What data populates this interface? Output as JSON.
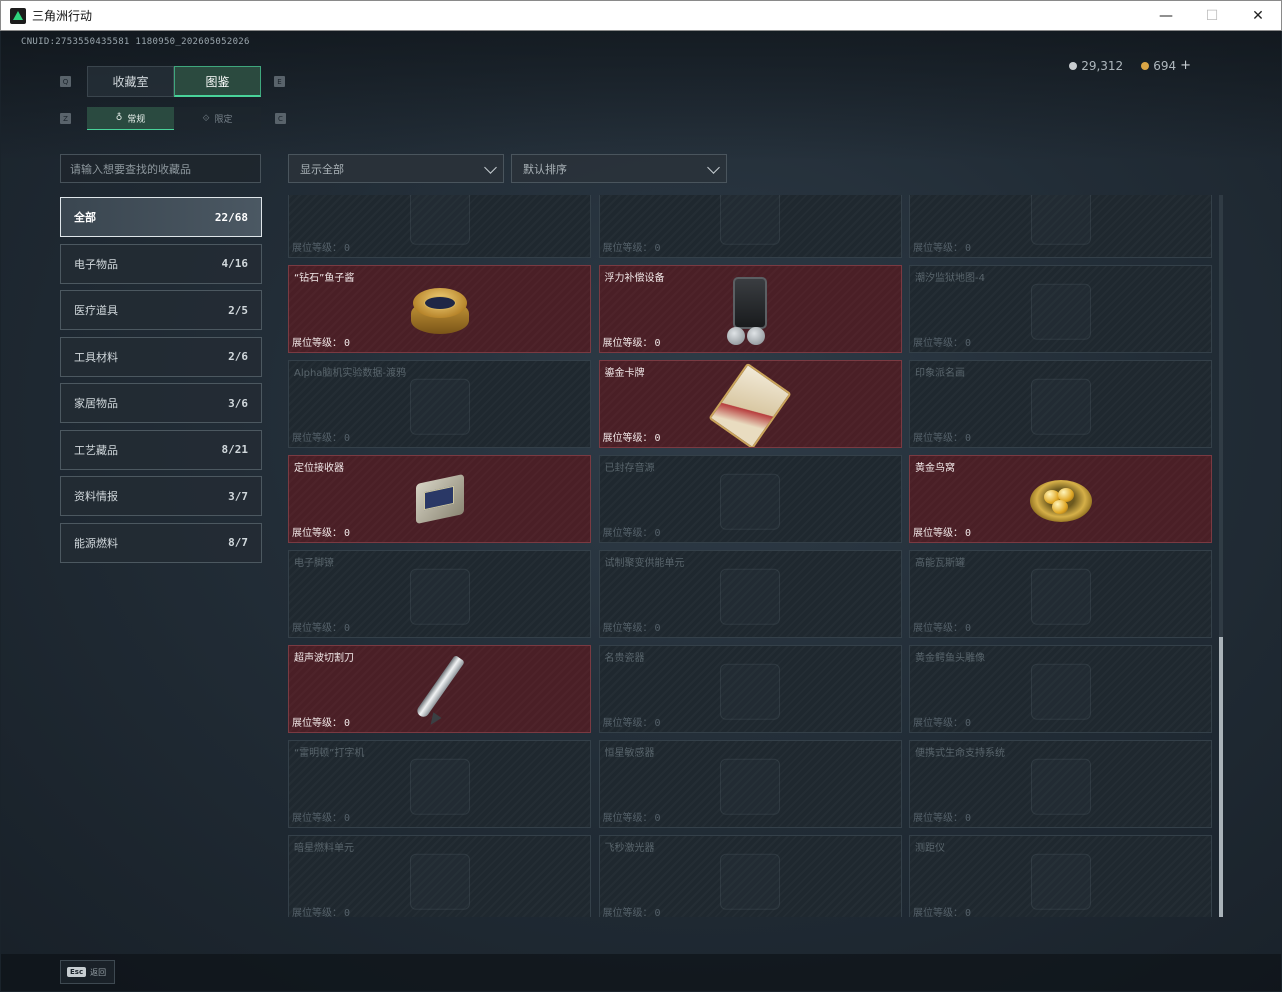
{
  "window": {
    "title": "三角洲行动",
    "minimize": "—",
    "maximize": "☐",
    "close": "✕"
  },
  "header": {
    "uid": "CNUID:2753550435581 1180950_202605052026",
    "currency": [
      {
        "icon": "silver-coin-icon",
        "value": "29,312"
      },
      {
        "icon": "gold-coin-icon",
        "value": "694"
      }
    ],
    "add_label": "+"
  },
  "tabs": {
    "main": [
      {
        "label": "收藏室",
        "active": false
      },
      {
        "label": "图鉴",
        "active": true
      }
    ],
    "sub": [
      {
        "label": "常规",
        "icon": "flask-icon",
        "active": true
      },
      {
        "label": "限定",
        "icon": "limited-icon",
        "active": false
      }
    ],
    "key_hints": [
      "Q",
      "E",
      "Z",
      "C"
    ]
  },
  "search": {
    "placeholder": "请输入想要查找的收藏品"
  },
  "filters": {
    "display": "显示全部",
    "sort": "默认排序"
  },
  "categories": [
    {
      "label": "全部",
      "count": "22/68",
      "active": true
    },
    {
      "label": "电子物品",
      "count": "4/16",
      "active": false
    },
    {
      "label": "医疗道具",
      "count": "2/5",
      "active": false
    },
    {
      "label": "工具材料",
      "count": "2/6",
      "active": false
    },
    {
      "label": "家居物品",
      "count": "3/6",
      "active": false
    },
    {
      "label": "工艺藏品",
      "count": "8/21",
      "active": false
    },
    {
      "label": "资料情报",
      "count": "3/7",
      "active": false
    },
    {
      "label": "能源燃料",
      "count": "8/7",
      "active": false
    }
  ],
  "level_label": "展位等级：",
  "items": [
    {
      "name": "",
      "level": "0",
      "owned": false
    },
    {
      "name": "",
      "level": "0",
      "owned": false
    },
    {
      "name": "",
      "level": "0",
      "owned": false
    },
    {
      "name": "“钻石”鱼子酱",
      "level": "0",
      "owned": true,
      "art": "caviar"
    },
    {
      "name": "浮力补偿设备",
      "level": "0",
      "owned": true,
      "art": "pack"
    },
    {
      "name": "潮汐监狱地图-4",
      "level": "0",
      "owned": false
    },
    {
      "name": "Alpha脑机实验数据-渡鸦",
      "level": "0",
      "owned": false
    },
    {
      "name": "鎏金卡牌",
      "level": "0",
      "owned": true,
      "art": "card"
    },
    {
      "name": "印象派名画",
      "level": "0",
      "owned": false
    },
    {
      "name": "定位接收器",
      "level": "0",
      "owned": true,
      "art": "receiver"
    },
    {
      "name": "已封存音源",
      "level": "0",
      "owned": false
    },
    {
      "name": "黄金鸟窝",
      "level": "0",
      "owned": true,
      "art": "nest"
    },
    {
      "name": "电子脚镣",
      "level": "0",
      "owned": false
    },
    {
      "name": "试制聚变供能单元",
      "level": "0",
      "owned": false
    },
    {
      "name": "高能瓦斯罐",
      "level": "0",
      "owned": false
    },
    {
      "name": "超声波切割刀",
      "level": "0",
      "owned": true,
      "art": "knife"
    },
    {
      "name": "名贵瓷器",
      "level": "0",
      "owned": false
    },
    {
      "name": "黄金鳄鱼头雕像",
      "level": "0",
      "owned": false
    },
    {
      "name": "“雷明顿”打字机",
      "level": "0",
      "owned": false
    },
    {
      "name": "恒星敏感器",
      "level": "0",
      "owned": false
    },
    {
      "name": "便携式生命支持系统",
      "level": "0",
      "owned": false
    },
    {
      "name": "暗星燃料单元",
      "level": "0",
      "owned": false
    },
    {
      "name": "飞秒激光器",
      "level": "0",
      "owned": false
    },
    {
      "name": "测距仪",
      "level": "0",
      "owned": false
    }
  ],
  "bottom": {
    "esc_key": "Esc",
    "esc_label": "返回"
  },
  "colors": {
    "accent": "#49d39a",
    "owned_card": "#4a1f26",
    "locked_card": "#1f282f"
  }
}
